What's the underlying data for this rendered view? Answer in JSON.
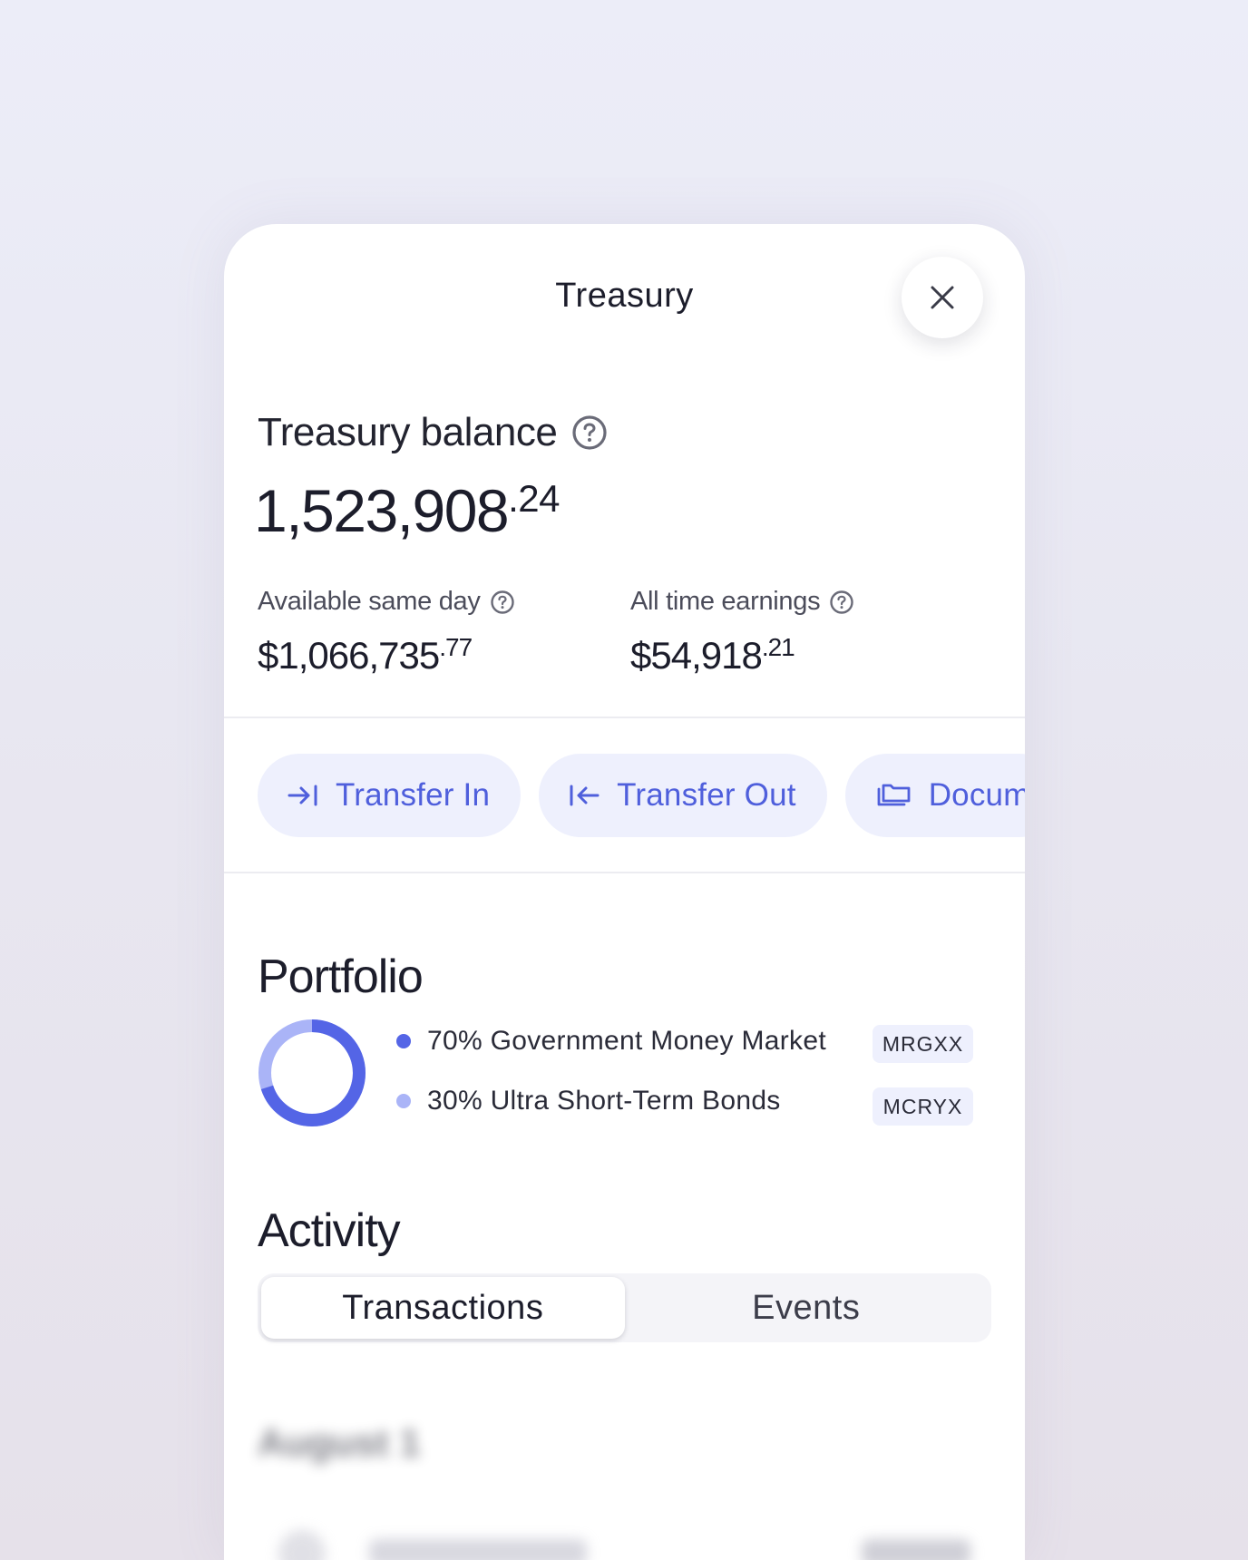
{
  "header": {
    "title": "Treasury"
  },
  "balance": {
    "label": "Treasury balance",
    "whole": "1,523,908",
    "cents": ".24"
  },
  "stats": {
    "available": {
      "label": "Available same day",
      "whole": "$1,066,735",
      "cents": ".77"
    },
    "earnings": {
      "label": "All time earnings",
      "whole": "$54,918",
      "cents": ".21"
    }
  },
  "actions": {
    "transfer_in": "Transfer In",
    "transfer_out": "Transfer Out",
    "documents": "Docum"
  },
  "portfolio": {
    "title": "Portfolio",
    "items": [
      {
        "label": "70% Government Money Market",
        "ticker": "MRGXX",
        "share": 70,
        "color": "#5465e6"
      },
      {
        "label": "30% Ultra Short-Term Bonds",
        "ticker": "MCRYX",
        "share": 30,
        "color": "#aab4f7"
      }
    ]
  },
  "activity": {
    "title": "Activity",
    "tabs": [
      "Transactions",
      "Events"
    ],
    "active_tab": "Transactions",
    "blurred_heading": "August 1"
  },
  "colors": {
    "accent": "#4f5fdc",
    "accent_bg": "#eef0fd"
  }
}
